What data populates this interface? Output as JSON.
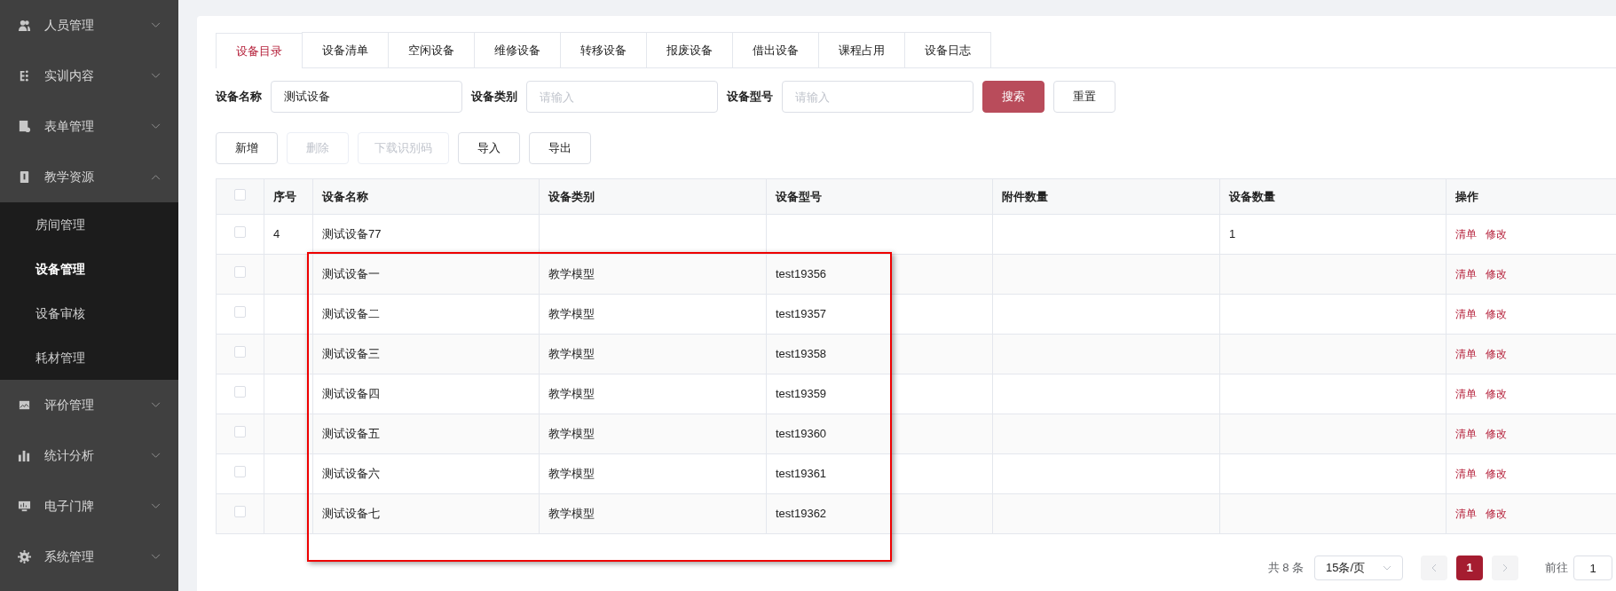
{
  "sidebar": {
    "items": [
      {
        "label": "人员管理",
        "expanded": false
      },
      {
        "label": "实训内容",
        "expanded": false
      },
      {
        "label": "表单管理",
        "expanded": false
      },
      {
        "label": "教学资源",
        "expanded": true,
        "children": [
          {
            "label": "房间管理",
            "selected": false
          },
          {
            "label": "设备管理",
            "selected": true
          },
          {
            "label": "设备审核",
            "selected": false
          },
          {
            "label": "耗材管理",
            "selected": false
          }
        ]
      },
      {
        "label": "评价管理",
        "expanded": false
      },
      {
        "label": "统计分析",
        "expanded": false
      },
      {
        "label": "电子门牌",
        "expanded": false
      },
      {
        "label": "系统管理",
        "expanded": false
      }
    ]
  },
  "tabs": [
    {
      "label": "设备目录",
      "selected": true
    },
    {
      "label": "设备清单",
      "selected": false
    },
    {
      "label": "空闲设备",
      "selected": false
    },
    {
      "label": "维修设备",
      "selected": false
    },
    {
      "label": "转移设备",
      "selected": false
    },
    {
      "label": "报废设备",
      "selected": false
    },
    {
      "label": "借出设备",
      "selected": false
    },
    {
      "label": "课程占用",
      "selected": false
    },
    {
      "label": "设备日志",
      "selected": false
    }
  ],
  "filters": [
    {
      "label": "设备名称",
      "value": "测试设备"
    },
    {
      "label": "设备类别",
      "placeholder": "请输入"
    },
    {
      "label": "设备型号",
      "placeholder": "请输入"
    }
  ],
  "search_buttons": [
    {
      "label": "搜索",
      "kind": "primary"
    },
    {
      "label": "重置",
      "kind": "plain"
    }
  ],
  "toolbar": [
    {
      "label": "新增",
      "disabled": false
    },
    {
      "label": "删除",
      "disabled": true
    },
    {
      "label": "下载识别码",
      "disabled": true
    },
    {
      "label": "导入",
      "disabled": false
    },
    {
      "label": "导出",
      "disabled": false
    }
  ],
  "table": {
    "header_checked": false,
    "columns": [
      "序号",
      "设备名称",
      "设备类别",
      "设备型号",
      "附件数量",
      "设备数量",
      "操作"
    ],
    "rows": [
      {
        "checked": false,
        "cells": [
          "4",
          "测试设备77",
          "",
          "",
          "",
          "1"
        ],
        "actions": [
          "清单",
          "修改"
        ]
      },
      {
        "checked": false,
        "cells": [
          "",
          "测试设备一",
          "教学模型",
          "test19356",
          "",
          ""
        ],
        "actions": [
          "清单",
          "修改"
        ]
      },
      {
        "checked": false,
        "cells": [
          "",
          "测试设备二",
          "教学模型",
          "test19357",
          "",
          ""
        ],
        "actions": [
          "清单",
          "修改"
        ]
      },
      {
        "checked": false,
        "cells": [
          "",
          "测试设备三",
          "教学模型",
          "test19358",
          "",
          ""
        ],
        "actions": [
          "清单",
          "修改"
        ]
      },
      {
        "checked": false,
        "cells": [
          "",
          "测试设备四",
          "教学模型",
          "test19359",
          "",
          ""
        ],
        "actions": [
          "清单",
          "修改"
        ]
      },
      {
        "checked": false,
        "cells": [
          "",
          "测试设备五",
          "教学模型",
          "test19360",
          "",
          ""
        ],
        "actions": [
          "清单",
          "修改"
        ]
      },
      {
        "checked": false,
        "cells": [
          "",
          "测试设备六",
          "教学模型",
          "test19361",
          "",
          ""
        ],
        "actions": [
          "清单",
          "修改"
        ]
      },
      {
        "checked": false,
        "cells": [
          "",
          "测试设备七",
          "教学模型",
          "test19362",
          "",
          ""
        ],
        "actions": [
          "清单",
          "修改"
        ]
      }
    ]
  },
  "pagination": {
    "total": "共 8 条",
    "page_size": "15条/页",
    "pages": [
      {
        "label": "1",
        "selected": true
      }
    ],
    "goto_label": "前往",
    "goto_value": "1"
  }
}
